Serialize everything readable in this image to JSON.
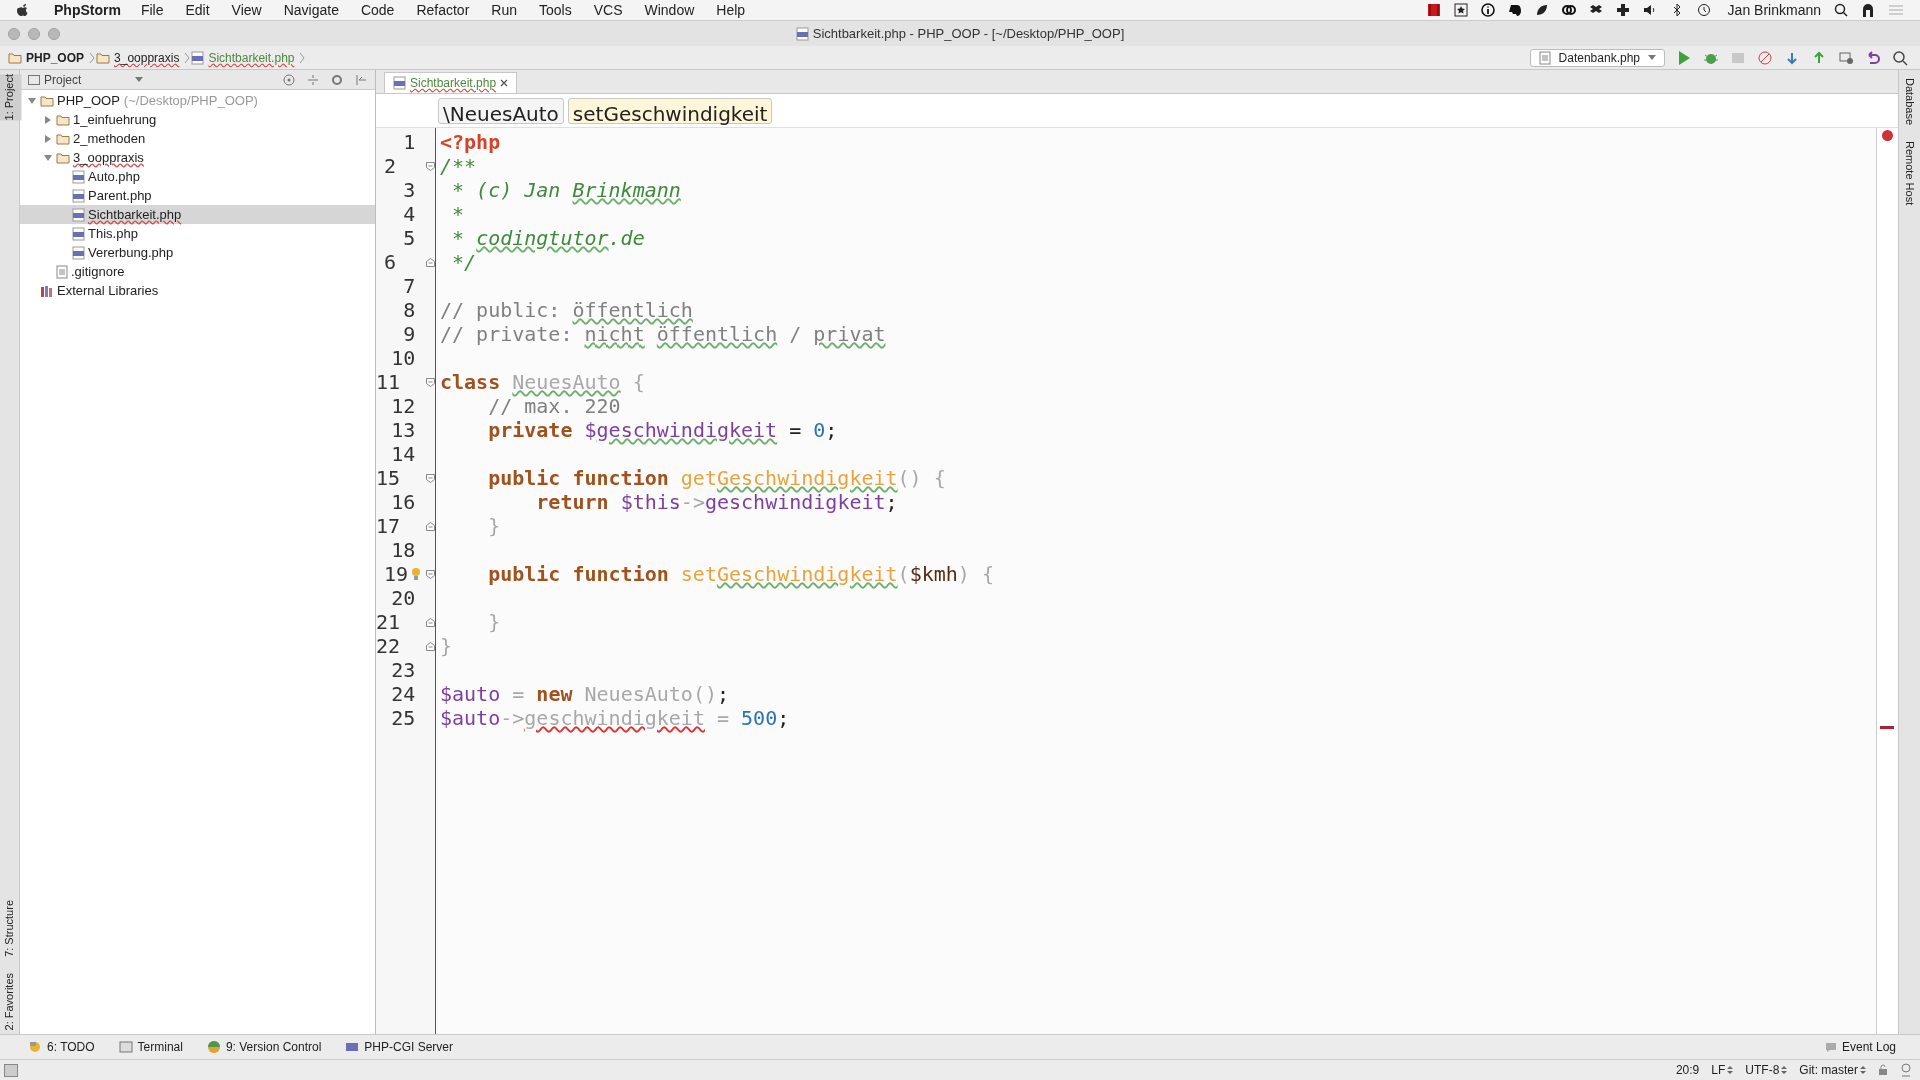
{
  "menu_bar": {
    "app": "PhpStorm",
    "items": [
      "File",
      "Edit",
      "View",
      "Navigate",
      "Code",
      "Refactor",
      "Run",
      "Tools",
      "VCS",
      "Window",
      "Help"
    ],
    "user": "Jan Brinkmann"
  },
  "window": {
    "title": "Sichtbarkeit.php - PHP_OOP - [~/Desktop/PHP_OOP]"
  },
  "nav_bar": {
    "crumbs": [
      {
        "label": "PHP_OOP",
        "kind": "project"
      },
      {
        "label": "3_ooppraxis",
        "kind": "folder"
      },
      {
        "label": "Sichtbarkeit.php",
        "kind": "php"
      }
    ],
    "run_config": "Datenbank.php"
  },
  "left_strip": [
    {
      "label": "1: Project",
      "selected": true
    },
    {
      "label": "7: Structure",
      "selected": false
    },
    {
      "label": "2: Favorites",
      "selected": false
    }
  ],
  "project_panel": {
    "header": "Project",
    "tree": [
      {
        "label": "PHP_OOP",
        "path": "(~/Desktop/PHP_OOP)",
        "kind": "folder",
        "expanded": true,
        "selected": false,
        "children": [
          {
            "label": "1_einfuehrung",
            "kind": "folder",
            "expanded": false,
            "selected": false
          },
          {
            "label": "2_methoden",
            "kind": "folder",
            "expanded": false,
            "selected": false
          },
          {
            "label": "3_ooppraxis",
            "kind": "folder",
            "expanded": true,
            "selected": false,
            "children": [
              {
                "label": "Auto.php",
                "kind": "php",
                "selected": false
              },
              {
                "label": "Parent.php",
                "kind": "php",
                "selected": false
              },
              {
                "label": "Sichtbarkeit.php",
                "kind": "php",
                "selected": true
              },
              {
                "label": "This.php",
                "kind": "php",
                "selected": false
              },
              {
                "label": "Vererbung.php",
                "kind": "php",
                "selected": false
              }
            ]
          },
          {
            "label": ".gitignore",
            "kind": "file",
            "selected": false
          }
        ]
      },
      {
        "label": "External Libraries",
        "kind": "library",
        "selected": false
      }
    ]
  },
  "editor": {
    "tabs": [
      {
        "label": "Sichtbarkeit.php",
        "selected": true
      }
    ],
    "breadcrumbs": [
      "\\NeuesAuto",
      "setGeschwindigkeit"
    ],
    "lines": [
      {
        "n": "1",
        "tokens": [
          {
            "kind": "tag",
            "text": "<?php"
          }
        ]
      },
      {
        "n": "2",
        "fold_start": true,
        "tokens": [
          {
            "kind": "doc",
            "text": "/**"
          }
        ]
      },
      {
        "n": "3",
        "tokens": [
          {
            "kind": "doc",
            "text": " * (c) Jan "
          },
          {
            "kind": "doc",
            "text": "Brinkmann",
            "typo": true
          }
        ]
      },
      {
        "n": "4",
        "tokens": [
          {
            "kind": "doc",
            "text": " *"
          }
        ]
      },
      {
        "n": "5",
        "tokens": [
          {
            "kind": "doc",
            "text": " * "
          },
          {
            "kind": "doc",
            "text": "codingtutor",
            "typo": true
          },
          {
            "kind": "doc",
            "text": ".de"
          }
        ]
      },
      {
        "n": "6",
        "fold_end": true,
        "tokens": [
          {
            "kind": "doc",
            "text": " */"
          }
        ]
      },
      {
        "n": "7"
      },
      {
        "n": "8",
        "tokens": [
          {
            "kind": "comment",
            "text": "// public: "
          },
          {
            "kind": "comment",
            "text": "öffentlich",
            "typo": true
          }
        ]
      },
      {
        "n": "9",
        "tokens": [
          {
            "kind": "comment",
            "text": "// private: "
          },
          {
            "kind": "comment",
            "text": "nicht",
            "typo": true
          },
          {
            "kind": "comment",
            "text": " öffentlich",
            "typo": true
          },
          {
            "kind": "comment",
            "text": " / "
          },
          {
            "kind": "comment",
            "text": "privat",
            "typo": true
          }
        ]
      },
      {
        "n": "10"
      },
      {
        "n": "11",
        "fold_start": true,
        "tokens": [
          {
            "kind": "kw",
            "text": "class"
          },
          {
            "kind": "dim",
            "text": " NeuesAuto",
            "typo": true
          },
          {
            "kind": "dim",
            "text": " {"
          }
        ]
      },
      {
        "n": "12",
        "tokens": [
          {
            "kind": "comment",
            "text": "    // max. 220"
          }
        ]
      },
      {
        "n": "13",
        "tokens": [
          {
            "kind": "kw",
            "text": "    private "
          },
          {
            "kind": "var",
            "text": "$"
          },
          {
            "kind": "var",
            "text": "geschwindigkeit",
            "typo": true
          },
          {
            "kind": "plain",
            "text": " = "
          },
          {
            "kind": "num",
            "text": "0"
          },
          {
            "kind": "plain",
            "text": ";"
          }
        ]
      },
      {
        "n": "14"
      },
      {
        "n": "15",
        "fold_start": true,
        "tokens": [
          {
            "kind": "kw",
            "text": "    public function "
          },
          {
            "kind": "fn",
            "text": "get"
          },
          {
            "kind": "fn",
            "text": "Geschwindigkeit",
            "typo": true
          },
          {
            "kind": "dim",
            "text": "() {"
          }
        ]
      },
      {
        "n": "16",
        "tokens": [
          {
            "kind": "kw",
            "text": "        return "
          },
          {
            "kind": "var",
            "text": "$this"
          },
          {
            "kind": "dim",
            "text": "->"
          },
          {
            "kind": "var",
            "text": "geschwindigkeit"
          },
          {
            "kind": "plain",
            "text": ";"
          }
        ]
      },
      {
        "n": "17",
        "fold_end": true,
        "tokens": [
          {
            "kind": "dim",
            "text": "    }"
          }
        ]
      },
      {
        "n": "18"
      },
      {
        "n": "19",
        "fold_start": true,
        "bulb": true,
        "tokens": [
          {
            "kind": "kw",
            "text": "    public function "
          },
          {
            "kind": "fn",
            "text": "set"
          },
          {
            "kind": "fn",
            "text": "Geschwindigkeit",
            "typo": true
          },
          {
            "kind": "dim",
            "text": "("
          },
          {
            "kind": "param",
            "text": "$kmh"
          },
          {
            "kind": "dim",
            "text": ") {"
          }
        ]
      },
      {
        "n": "20"
      },
      {
        "n": "21",
        "fold_end": true,
        "tokens": [
          {
            "kind": "dim",
            "text": "    }"
          }
        ]
      },
      {
        "n": "22",
        "fold_end": true,
        "tokens": [
          {
            "kind": "dim",
            "text": "}"
          }
        ]
      },
      {
        "n": "23"
      },
      {
        "n": "24",
        "tokens": [
          {
            "kind": "var",
            "text": "$auto"
          },
          {
            "kind": "dim",
            "text": " = "
          },
          {
            "kind": "kw",
            "text": "new"
          },
          {
            "kind": "dim",
            "text": " NeuesAuto()"
          },
          {
            "kind": "plain",
            "text": ";"
          }
        ]
      },
      {
        "n": "25",
        "tokens": [
          {
            "kind": "var",
            "text": "$auto"
          },
          {
            "kind": "dim",
            "text": "->"
          },
          {
            "kind": "dim",
            "text": "geschwindigkeit",
            "error": true
          },
          {
            "kind": "dim",
            "text": " = "
          },
          {
            "kind": "num",
            "text": "500"
          },
          {
            "kind": "plain",
            "text": ";"
          }
        ]
      }
    ]
  },
  "right_strip": [
    "Database",
    "Remote Host"
  ],
  "tool_windows": [
    {
      "label": "6: TODO",
      "kind": "todo"
    },
    {
      "label": "Terminal",
      "kind": "terminal"
    },
    {
      "label": "9: Version Control",
      "kind": "vcs"
    },
    {
      "label": "PHP-CGI Server",
      "kind": "php"
    }
  ],
  "event_log": "Event Log",
  "status_bar": [
    {
      "label": "20:9",
      "kind": "plain"
    },
    {
      "label": "LF",
      "kind": "select"
    },
    {
      "label": "UTF-8",
      "kind": "select"
    },
    {
      "label": "Git: master",
      "kind": "select"
    }
  ]
}
